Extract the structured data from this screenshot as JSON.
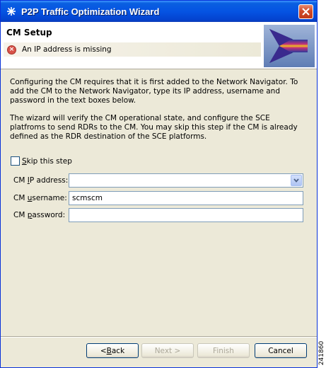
{
  "window": {
    "title": "P2P Traffic Optimization Wizard",
    "icons": {
      "app": "cisco-wizard-icon",
      "close": "close-icon"
    }
  },
  "header": {
    "title": "CM Setup",
    "error_message": "An IP address is missing",
    "error_icon": "error-icon",
    "banner_icon": "wizard-banner-icon"
  },
  "body": {
    "paragraph1": "Configuring the CM requires that it is first added to the Network Navigator. To add the CM to the Network Navigator, type its IP address, username and password in the text boxes below.",
    "paragraph2": "The wizard will verify the CM operational state, and configure the SCE platfroms to send RDRs to the CM. You may skip this step if the CM is already defined as the RDR destination of the SCE platforms.",
    "skip_label_mnemonic": "S",
    "skip_label_rest": "kip this step",
    "skip_checked": false
  },
  "fields": {
    "ip_label_a": "CM ",
    "ip_label_m": "I",
    "ip_label_b": "P address:",
    "ip_value": "",
    "user_label_a": "CM ",
    "user_label_m": "u",
    "user_label_b": "sername:",
    "user_value": "scmscm",
    "pass_label_a": "CM ",
    "pass_label_m": "p",
    "pass_label_b": "assword:",
    "pass_value": ""
  },
  "buttons": {
    "back_a": "< ",
    "back_m": "B",
    "back_b": "ack",
    "next": "Next >",
    "finish": "Finish",
    "cancel": "Cancel"
  },
  "side_code": "241860"
}
